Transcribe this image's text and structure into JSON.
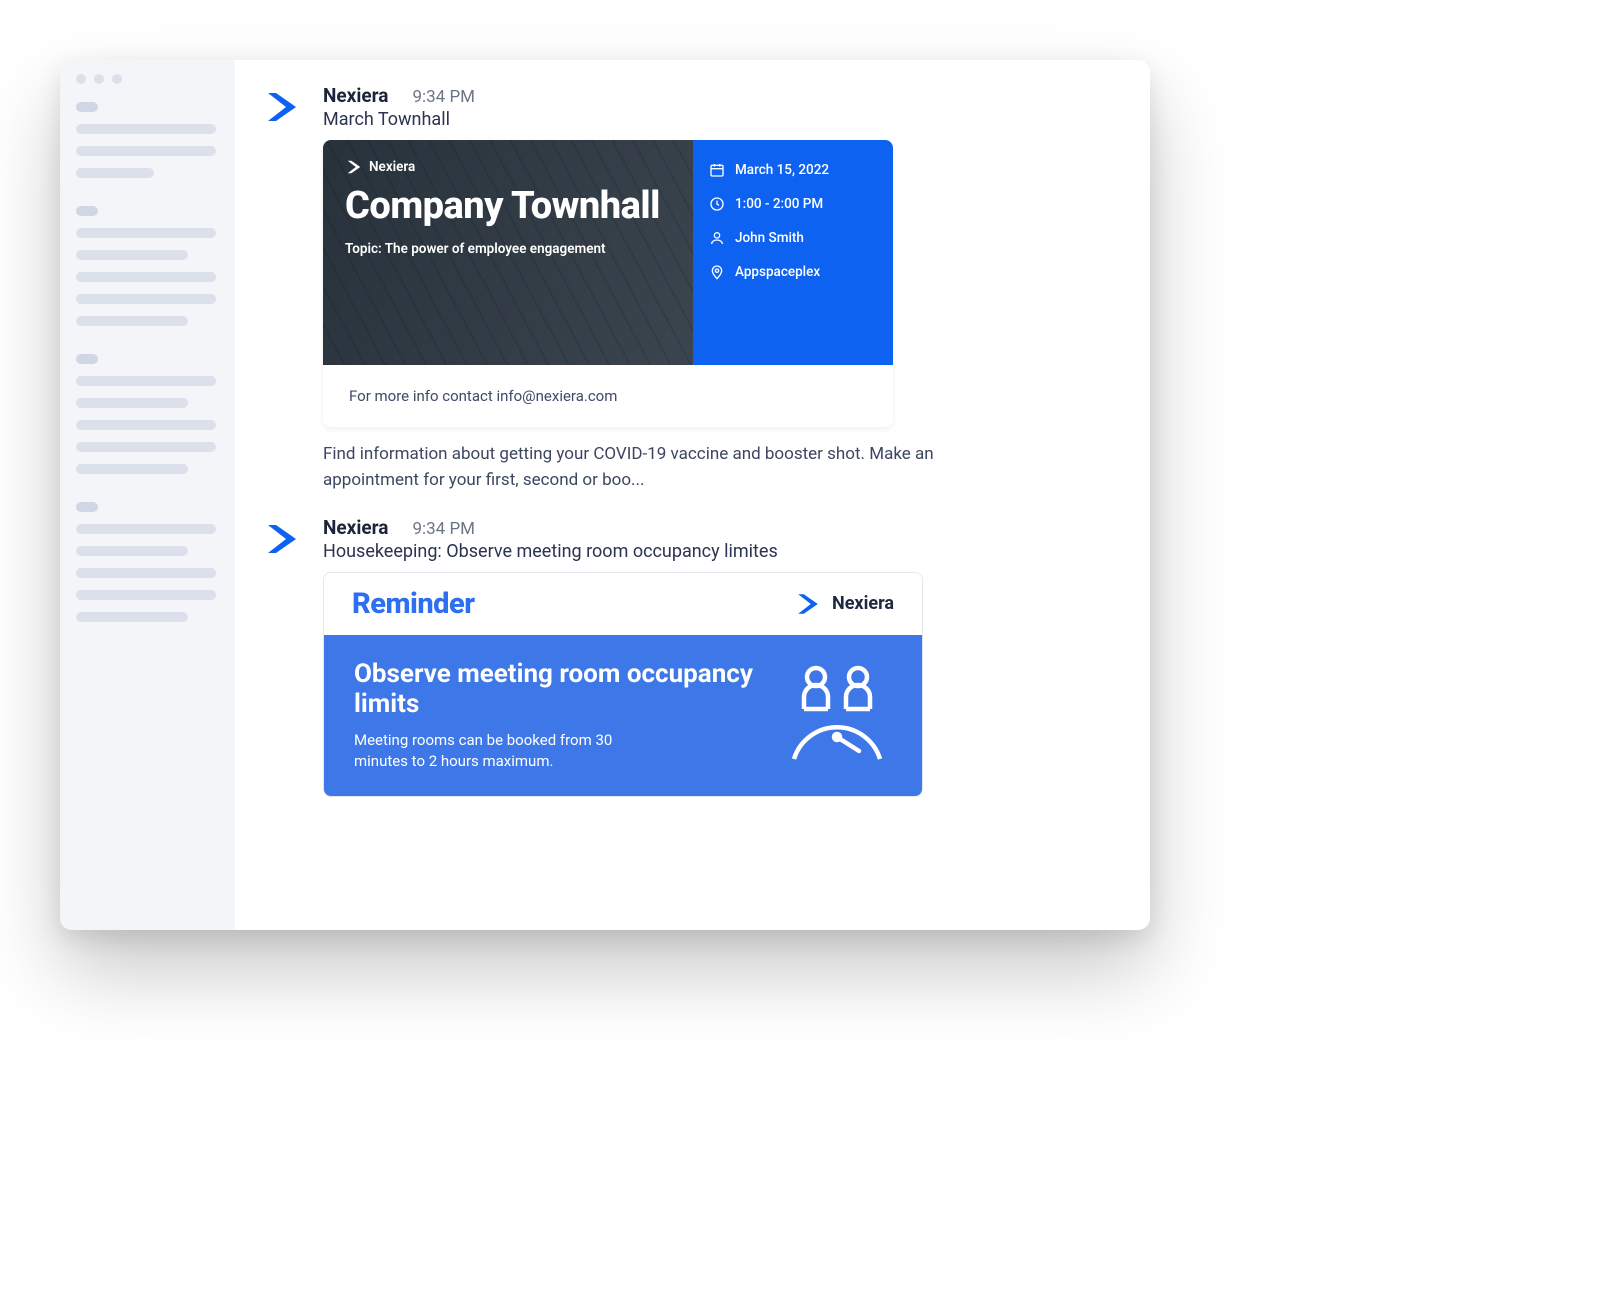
{
  "posts": [
    {
      "author": "Nexiera",
      "time": "9:34 PM",
      "title": "March Townhall",
      "card": {
        "brand": "Nexiera",
        "heading": "Company Townhall",
        "topic": "Topic: The power of employee engagement",
        "meta": {
          "date": "March 15, 2022",
          "time": "1:00 - 2:00 PM",
          "host": "John Smith",
          "location": "Appspaceplex"
        },
        "footer": "For more info contact info@nexiera.com"
      },
      "description": "Find information about getting your COVID-19 vaccine and booster shot. Make an appointment for your first, second or boo..."
    },
    {
      "author": "Nexiera",
      "time": "9:34 PM",
      "title": "Housekeeping: Observe meeting room occupancy limites",
      "reminder": {
        "label": "Reminder",
        "brand": "Nexiera",
        "heading": "Observe meeting room occupancy limits",
        "sub": "Meeting rooms can be booked from 30 minutes to 2 hours maximum."
      }
    }
  ]
}
